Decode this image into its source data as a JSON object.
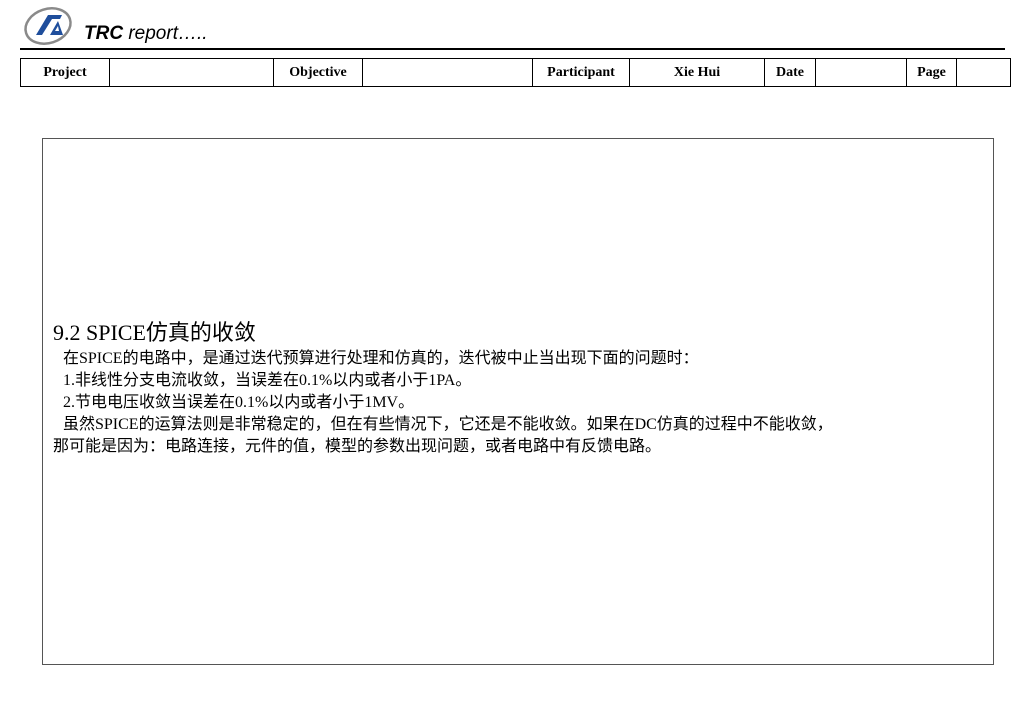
{
  "header": {
    "brand": "TRC",
    "title_suffix": " report….."
  },
  "meta_table": {
    "project_label": "Project",
    "project_value": "",
    "objective_label": "Objective",
    "objective_value": "",
    "participant_label": "Participant",
    "participant_value": "Xie Hui",
    "date_label": "Date",
    "date_value": "",
    "page_label": "Page",
    "page_value": ""
  },
  "content": {
    "heading": "9.2 SPICE仿真的收敛",
    "lines": [
      "在SPICE的电路中，是通过迭代预算进行处理和仿真的，迭代被中止当出现下面的问题时：",
      "1.非线性分支电流收敛，当误差在0.1%以内或者小于1PA。",
      "2.节电电压收敛当误差在0.1%以内或者小于1MV。",
      "虽然SPICE的运算法则是非常稳定的，但在有些情况下，它还是不能收敛。如果在DC仿真的过程中不能收敛，",
      "那可能是因为：电路连接，元件的值，模型的参数出现问题，或者电路中有反馈电路。"
    ]
  },
  "colors": {
    "logo_blue": "#1f4e9c",
    "logo_gray": "#8a8a8a",
    "text": "#000000"
  }
}
